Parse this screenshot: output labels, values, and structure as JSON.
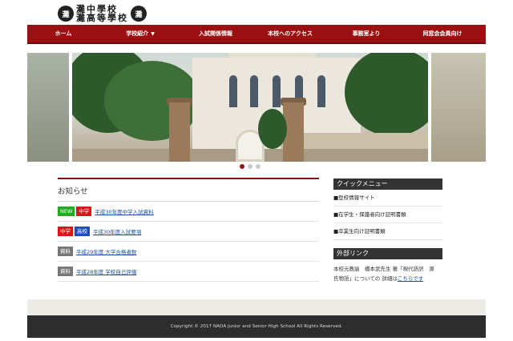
{
  "logo": {
    "line1": "灘中學校",
    "line2": "灘高等學校",
    "crest_text": "灘"
  },
  "nav": {
    "items": [
      {
        "label": "ホーム"
      },
      {
        "label": "学校紹介"
      },
      {
        "label": "入試関係情報"
      },
      {
        "label": "本校へのアクセス"
      },
      {
        "label": "事務室より"
      },
      {
        "label": "同窓会会員向け"
      }
    ]
  },
  "slider": {
    "dot_count": 3,
    "active_index": 0
  },
  "news": {
    "title": "お知らせ",
    "items": [
      {
        "badges": [
          {
            "label": "NEW",
            "kind": "new"
          },
          {
            "label": "中学",
            "kind": "jhs"
          }
        ],
        "link": "平成30年度中学入試資料"
      },
      {
        "badges": [
          {
            "label": "中学",
            "kind": "jhs"
          },
          {
            "label": "高校",
            "kind": "hs"
          }
        ],
        "link": "平成30年度入試要項"
      },
      {
        "badges": [
          {
            "label": "資料",
            "kind": "doc"
          }
        ],
        "link": "平成29年度 大学合格者数"
      },
      {
        "badges": [
          {
            "label": "資料",
            "kind": "doc"
          }
        ],
        "link": "平成28年度 学校自己評価"
      }
    ]
  },
  "quick_menu": {
    "title": "クイックメニュー",
    "items": [
      {
        "label": "■登校情報サイト"
      },
      {
        "label": "■在学生・保護者向け証明書類"
      },
      {
        "label": "■卒業生向け証明書類"
      }
    ]
  },
  "external_links": {
    "title": "外部リンク",
    "line1": "本校元教諭　橋本武先生 著「現代語訳　源",
    "line2_prefix": "氏物語」についての 詳細は",
    "link_text": "こちらです"
  },
  "footer": {
    "copyright": "Copyright © 2017 NADA Junior and Senior High School All Rights Reserved."
  },
  "colors": {
    "nav_bg": "#9b1010",
    "accent": "#8c1010",
    "new_badge": "#22aa22",
    "jhs_badge": "#d81818",
    "hs_badge": "#1a4cc6",
    "doc_badge": "#777777",
    "footer_bg": "#2d2d2d"
  }
}
